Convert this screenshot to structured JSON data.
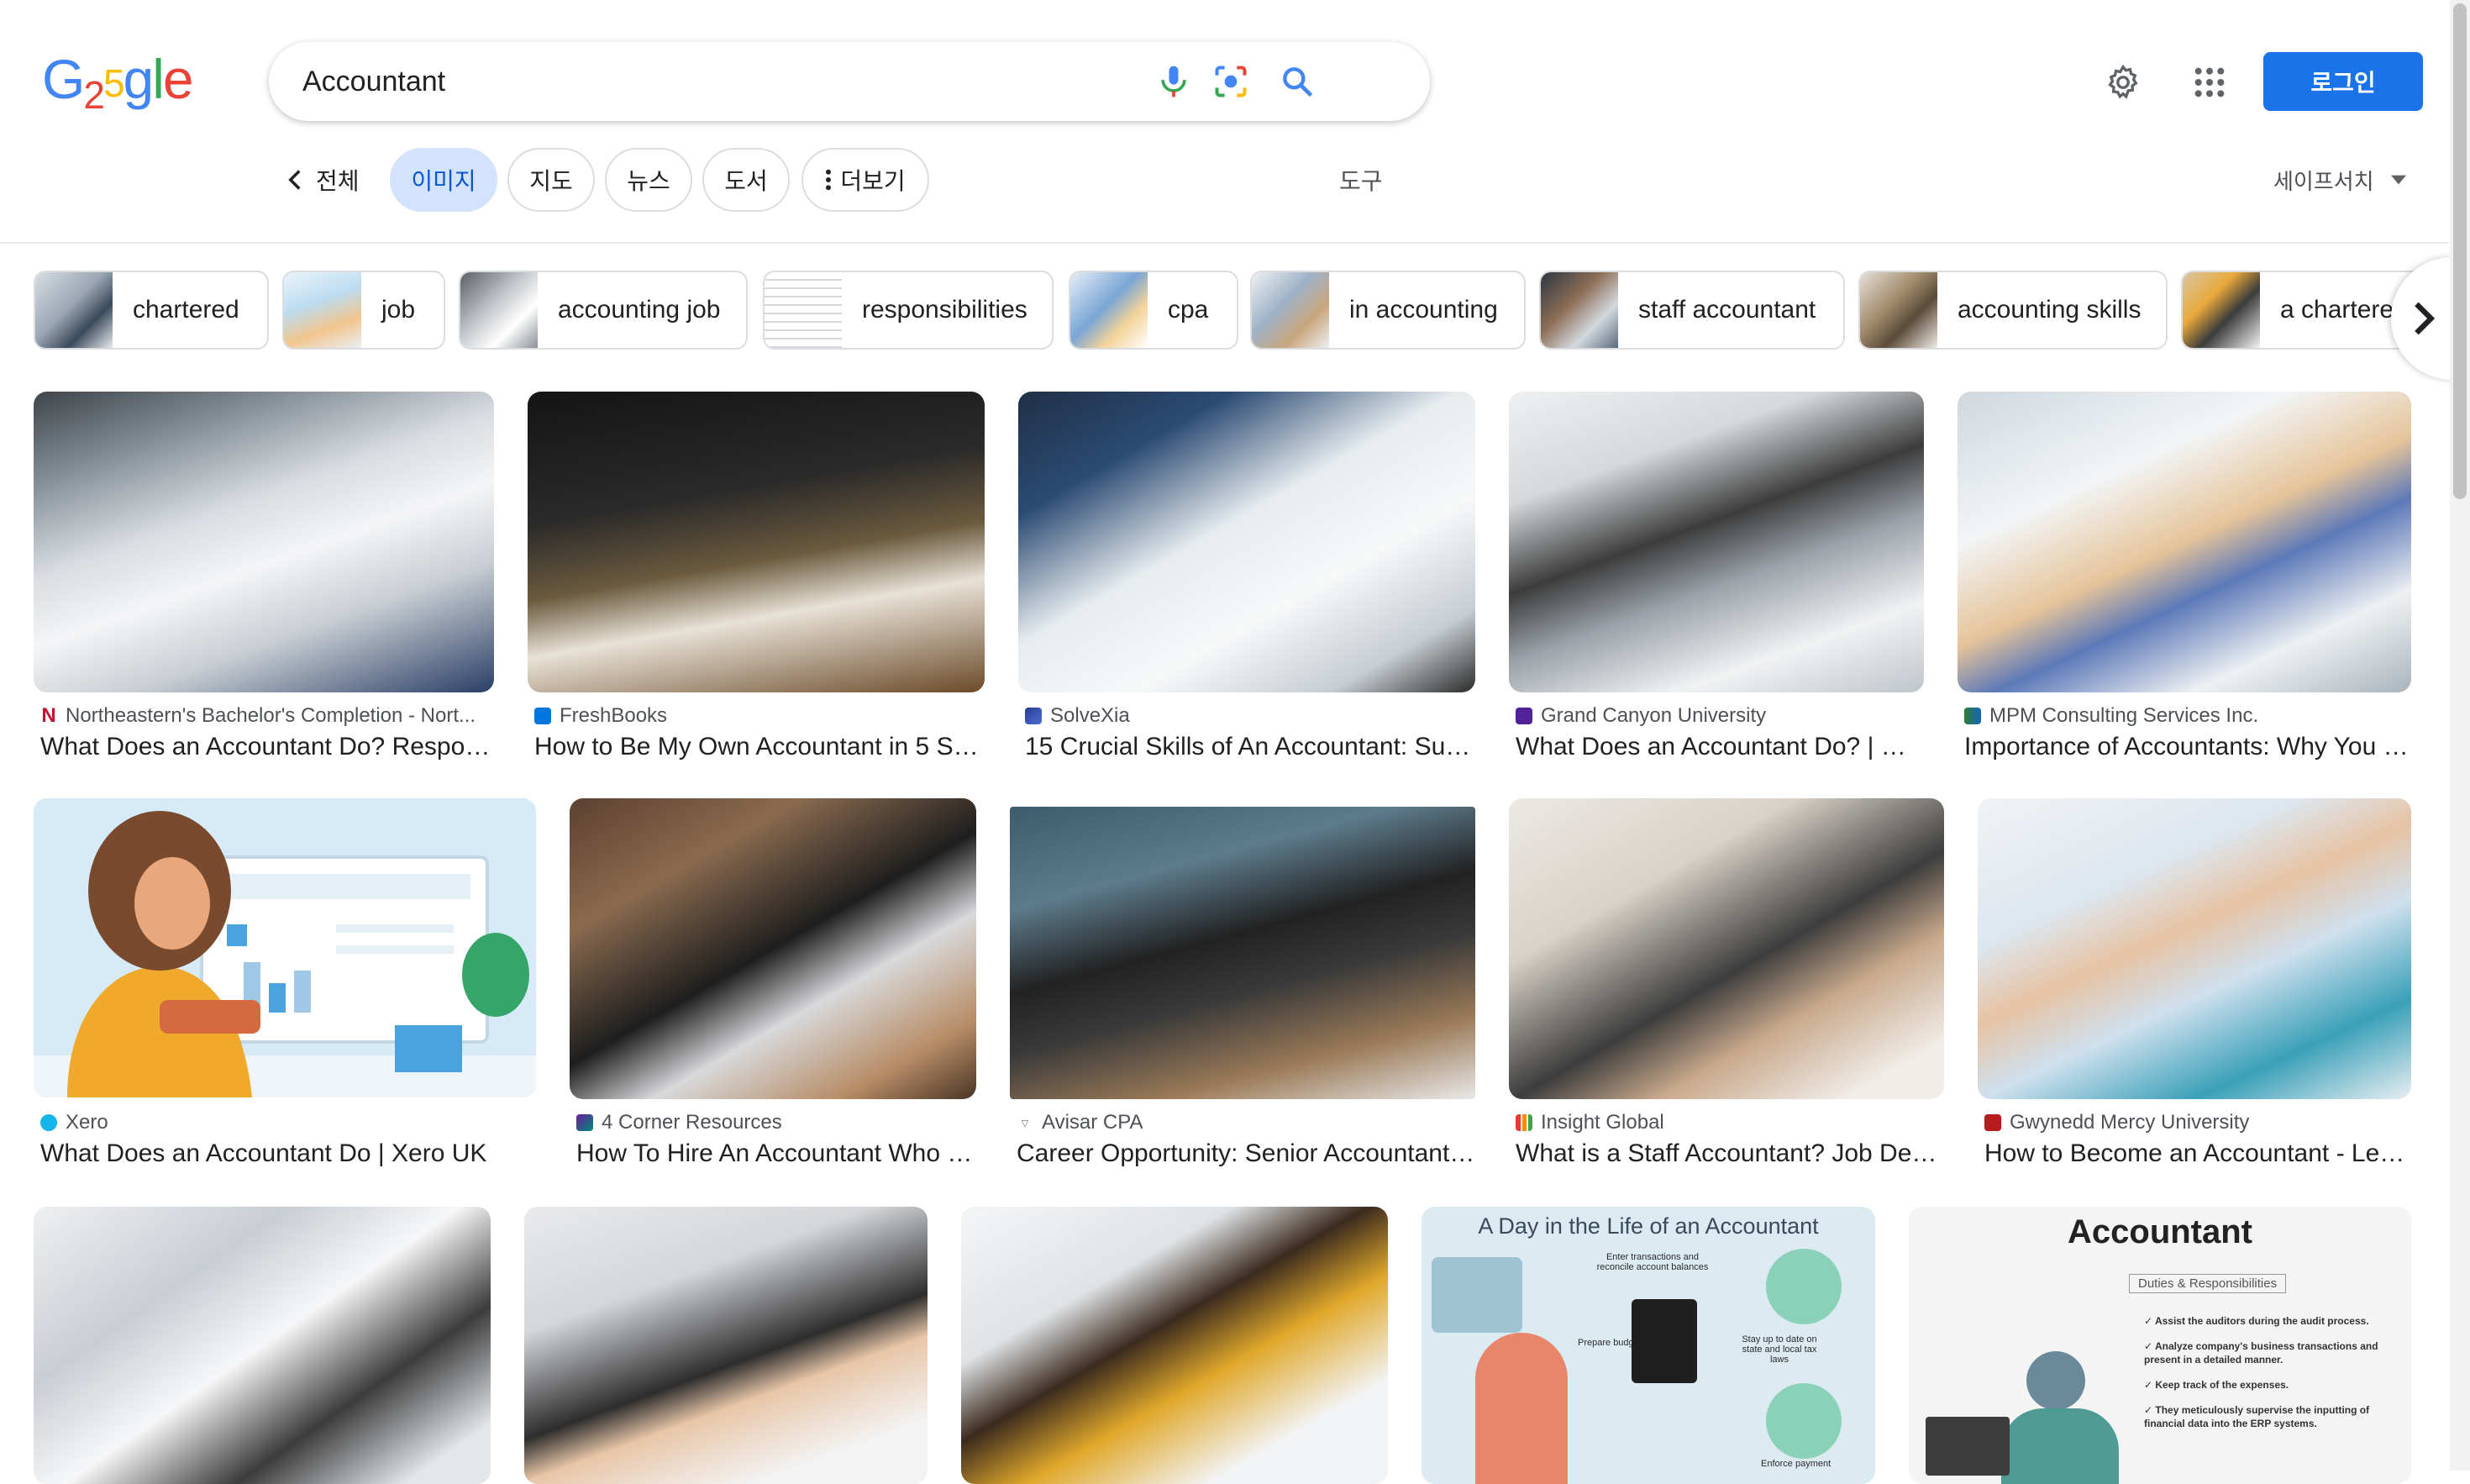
{
  "header": {
    "logo_text": "G25gle",
    "search_value": "Accountant",
    "login_label": "로그인",
    "icons": [
      "mic-icon",
      "camera-lens-icon",
      "search-icon",
      "gear-icon",
      "apps-grid-icon"
    ]
  },
  "tabs": {
    "back_label": "전체",
    "items": [
      "이미지",
      "지도",
      "뉴스",
      "도서"
    ],
    "more_label": "더보기",
    "tools_label": "도구",
    "safesearch_label": "세이프서치"
  },
  "chips": [
    "chartered",
    "job",
    "accounting job",
    "responsibilities",
    "cpa",
    "in accounting",
    "staff accountant",
    "accounting skills",
    "a chartere"
  ],
  "results": [
    {
      "source": "Northeastern's Bachelor's Completion - Nort...",
      "title": "What Does an Accountant Do? Respons..."
    },
    {
      "source": "FreshBooks",
      "title": "How to Be My Own Accountant in 5 Ste..."
    },
    {
      "source": "SolveXia",
      "title": "15 Crucial Skills of An Accountant: Suc..."
    },
    {
      "source": "Grand Canyon University",
      "title": "What Does an Accountant Do? | GC..."
    },
    {
      "source": "MPM Consulting Services Inc.",
      "title": "Importance of Accountants: Why You S..."
    },
    {
      "source": "Xero",
      "title": "What Does an Accountant Do | Xero UK"
    },
    {
      "source": "4 Corner Resources",
      "title": "How To Hire An Accountant Who Is..."
    },
    {
      "source": "Avisar CPA",
      "title": "Career Opportunity: Senior Accountant - ..."
    },
    {
      "source": "Insight Global",
      "title": "What is a Staff Accountant? Job Des..."
    },
    {
      "source": "Gwynedd Mercy University",
      "title": "How to Become an Accountant - Lear..."
    }
  ],
  "image_texts": {
    "day_in_life": "A Day in the Life of an Accountant",
    "day_enter": "Enter transactions and reconcile account balances",
    "day_budgets": "Prepare budgets",
    "day_tax": "Stay up to date on state and local tax laws",
    "day_enforce": "Enforce payment",
    "acc_title": "Accountant",
    "acc_duties": "Duties & Responsibilities",
    "acc_b1": "Assist the auditors during the audit process.",
    "acc_b2": "Analyze company's business transactions and present in a detailed manner.",
    "acc_b3": "Keep track of the expenses.",
    "acc_b4": "They meticulously supervise the inputting of financial data into the ERP systems."
  },
  "colors": {
    "accent": "#1a73e8",
    "active_tab_bg": "#d3e3fd",
    "active_tab_text": "#0b57d0"
  }
}
